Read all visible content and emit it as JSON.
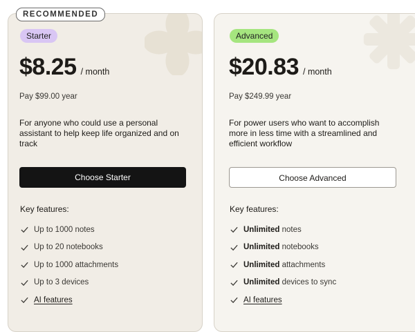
{
  "ribbon": "RECOMMENDED",
  "plans": {
    "starter": {
      "badge": "Starter",
      "price": "$8.25",
      "per": "/ month",
      "yearly": "Pay $99.00 year",
      "description": "For anyone who could use a personal assistant to help keep life organized and on track",
      "cta": "Choose Starter",
      "features_title": "Key features:",
      "features": [
        "Up to 1000 notes",
        "Up to 20 notebooks",
        "Up to 1000 attachments",
        "Up to 3 devices",
        "AI features"
      ]
    },
    "advanced": {
      "badge": "Advanced",
      "price": "$20.83",
      "per": "/ month",
      "yearly": "Pay $249.99 year",
      "description": "For power users who want to accomplish more in less time with a streamlined and efficient workflow",
      "cta": "Choose Advanced",
      "features_title": "Key features:",
      "features": [
        {
          "strong": "Unlimited",
          "rest": " notes"
        },
        {
          "strong": "Unlimited",
          "rest": " notebooks"
        },
        {
          "strong": "Unlimited",
          "rest": " attachments"
        },
        {
          "strong": "Unlimited",
          "rest": " devices to sync"
        },
        {
          "strong": "",
          "rest": "AI features"
        }
      ]
    }
  },
  "colors": {
    "starter_badge": "#d9c6f4",
    "advanced_badge": "#a5e57f",
    "starter_card": "#f1ede6",
    "advanced_card": "#f6f4ef",
    "primary_button": "#141414"
  },
  "icons": {
    "feature": "check-icon",
    "decoration": "flower-decoration"
  }
}
